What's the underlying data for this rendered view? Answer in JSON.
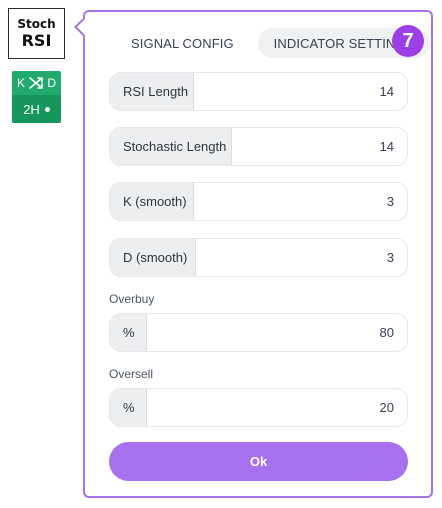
{
  "indicator": {
    "name_line1": "Stoch",
    "name_line2": "RSI"
  },
  "kd_badge": {
    "k_label": "K",
    "d_label": "D",
    "timeframe": "2H",
    "icon": "crossover-icon",
    "color": "#22a96e"
  },
  "tabs": [
    {
      "label": "SIGNAL CONFIG",
      "active": false
    },
    {
      "label": "INDICATOR SETTINGS",
      "active": true
    }
  ],
  "step": "7",
  "fields": {
    "rsi_length": {
      "label": "RSI Length",
      "value": "14"
    },
    "stochastic_length": {
      "label": "Stochastic Length",
      "value": "14"
    },
    "k_smooth": {
      "label": "K (smooth)",
      "value": "3"
    },
    "d_smooth": {
      "label": "D (smooth)",
      "value": "3"
    }
  },
  "overbuy": {
    "label": "Overbuy",
    "unit": "%",
    "value": "80"
  },
  "oversell": {
    "label": "Oversell",
    "unit": "%",
    "value": "20"
  },
  "ok_label": "Ok",
  "colors": {
    "accent": "#a772e8",
    "badge": "#9c3fe6",
    "button": "#a770ec",
    "green": "#22a96e"
  }
}
